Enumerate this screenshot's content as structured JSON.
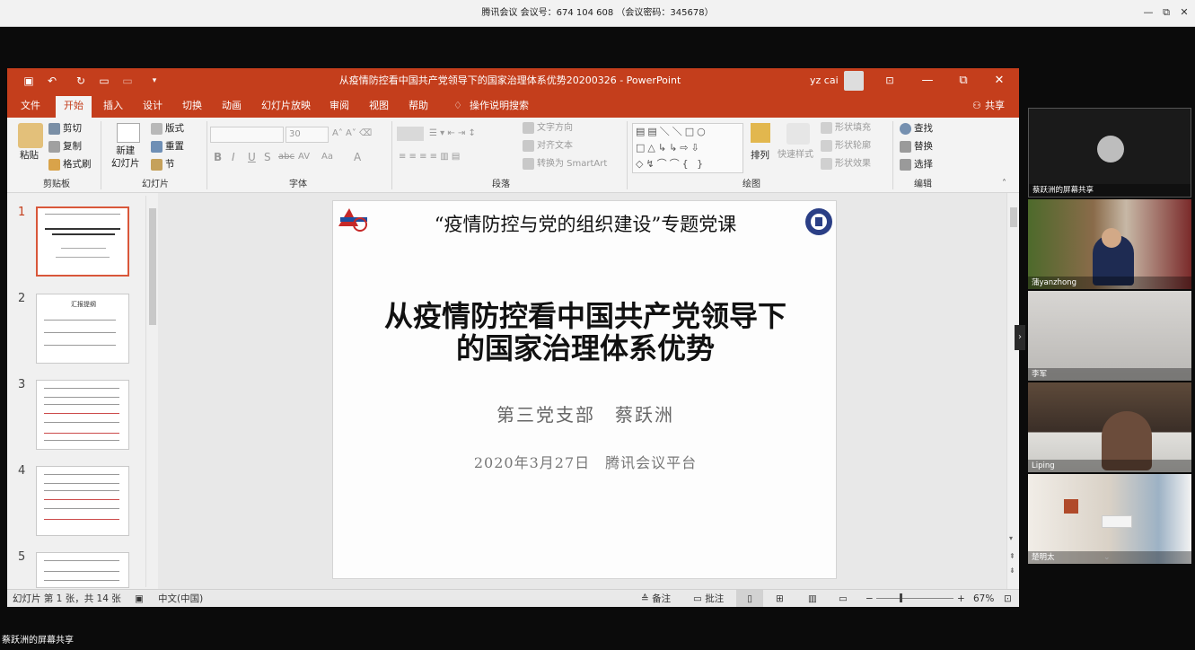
{
  "meeting": {
    "title": "腾讯会议 会议号：674 104 608 （会议密码：345678）",
    "minimize": "—",
    "restore": "⧉",
    "close": "✕",
    "self_share_label": "蔡跃洲的屏幕共享"
  },
  "ppt": {
    "window_title": "从疫情防控看中国共产党领导下的国家治理体系优势20200326 - PowerPoint",
    "user": "yz cai",
    "tabs": [
      "文件",
      "开始",
      "插入",
      "设计",
      "切换",
      "动画",
      "幻灯片放映",
      "审阅",
      "视图",
      "帮助",
      "操作说明搜索"
    ],
    "share_label": "共享",
    "ribbon": {
      "clipboard": {
        "paste": "粘贴",
        "cut": "剪切",
        "copy": "复制",
        "format_painter": "格式刷",
        "group": "剪贴板"
      },
      "slides": {
        "new_slide": "新建\n幻灯片",
        "layout": "版式",
        "reset": "重置",
        "section": "节",
        "group": "幻灯片"
      },
      "font": {
        "size": "30",
        "group": "字体",
        "buttons": [
          "B",
          "I",
          "U",
          "S",
          "abc",
          "AV",
          "Aa",
          "A"
        ]
      },
      "paragraph": {
        "text_direction": "文字方向",
        "align_text": "对齐文本",
        "convert_smartart": "转换为 SmartArt",
        "group": "段落"
      },
      "drawing": {
        "arrange": "排列",
        "quick_styles": "快速样式",
        "shape_fill": "形状填充",
        "shape_outline": "形状轮廓",
        "shape_effects": "形状效果",
        "group": "绘图"
      },
      "editing": {
        "find": "查找",
        "replace": "替换",
        "select": "选择",
        "group": "编辑"
      }
    },
    "thumb_numbers": [
      "1",
      "2",
      "3",
      "4",
      "5"
    ],
    "slide": {
      "header": "“疫情防控与党的组织建设”专题党课",
      "title_line1": "从疫情防控看中国共产党领导下",
      "title_line2": "的国家治理体系优势",
      "subtitle": "第三党支部　蔡跃洲",
      "date": "2020年3月27日　腾讯会议平台"
    },
    "thumb2_title": "汇报提纲",
    "status": {
      "slide_info": "幻灯片 第 1 张，共 14 张",
      "language": "中文(中国)",
      "notes": "备注",
      "comments": "批注",
      "zoom": "67%"
    }
  },
  "participants": [
    {
      "name": "蔡跃洲的屏幕共享"
    },
    {
      "name": "蒲yanzhong"
    },
    {
      "name": "李军"
    },
    {
      "name": "Liping"
    },
    {
      "name": "楚明太"
    }
  ],
  "colors": {
    "accent": "#c43e1c",
    "selection": "#d9573a"
  }
}
